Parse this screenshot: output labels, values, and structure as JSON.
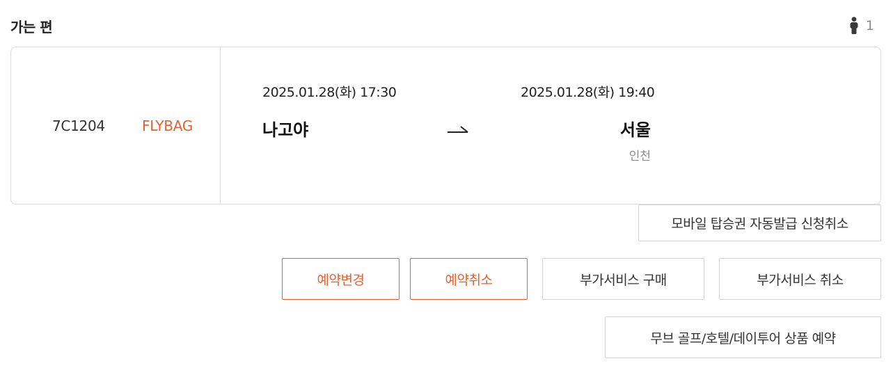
{
  "section": {
    "title": "가는 편"
  },
  "passengers": {
    "count": "1",
    "icon": "person-icon"
  },
  "flight": {
    "number": "7C1204",
    "carrier_tag": "FLYBAG",
    "departure": {
      "datetime": "2025.01.28(화) 17:30",
      "city": "나고야"
    },
    "arrival": {
      "datetime": "2025.01.28(화) 19:40",
      "city": "서울",
      "airport": "인천"
    },
    "arrow_icon": "arrow-right-icon"
  },
  "actions": {
    "mobile_boarding_cancel": "모바일 탑승권 자동발급 신청취소",
    "change_booking": "예약변경",
    "cancel_booking": "예약취소",
    "buy_addon": "부가서비스 구매",
    "cancel_addon": "부가서비스 취소",
    "move_golf_booking": "무브 골프/호텔/데이투어 상품 예약"
  },
  "colors": {
    "accent": "#e8612c",
    "border": "#dcdcdc",
    "muted": "#8a8a8a"
  }
}
